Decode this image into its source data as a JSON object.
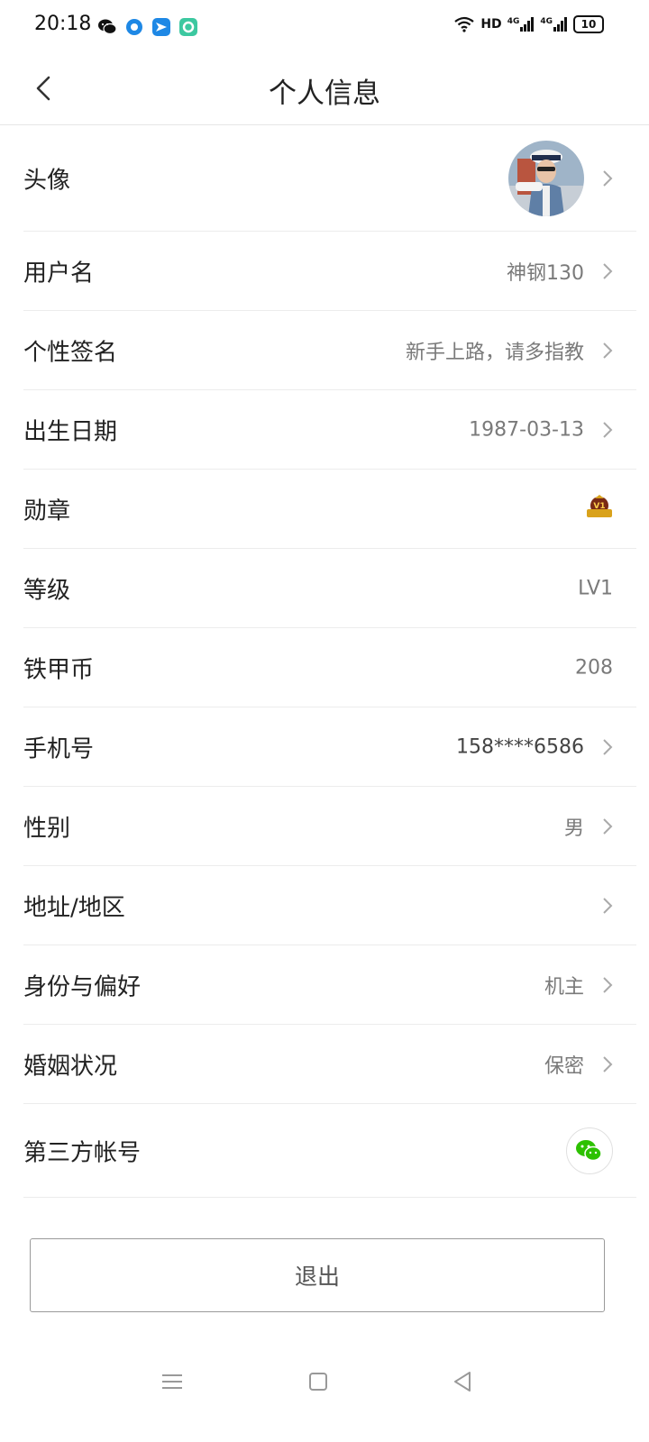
{
  "status_bar": {
    "time": "20:18",
    "network": "HD",
    "signal_1": "4G",
    "signal_2": "4G",
    "battery": "10"
  },
  "header": {
    "title": "个人信息"
  },
  "rows": {
    "avatar": {
      "label": "头像"
    },
    "username": {
      "label": "用户名",
      "value": "神钢130"
    },
    "signature": {
      "label": "个性签名",
      "value": "新手上路，请多指教"
    },
    "birthday": {
      "label": "出生日期",
      "value": "1987-03-13"
    },
    "medal": {
      "label": "勋章",
      "medal_text": "V1"
    },
    "level": {
      "label": "等级",
      "value": "LV1"
    },
    "coins": {
      "label": "铁甲币",
      "value": "208"
    },
    "phone": {
      "label": "手机号",
      "value": "158****6586"
    },
    "gender": {
      "label": "性别",
      "value": "男"
    },
    "address": {
      "label": "地址/地区",
      "value": ""
    },
    "identity": {
      "label": "身份与偏好",
      "value": "机主"
    },
    "marital": {
      "label": "婚姻状况",
      "value": "保密"
    },
    "third_party": {
      "label": "第三方帐号"
    }
  },
  "logout_label": "退出",
  "colors": {
    "wechat_green": "#2dc100",
    "medal_gold": "#d9a21b",
    "medal_dark": "#7a2a14"
  },
  "icons": [
    "back-icon",
    "chevron-right-icon",
    "wechat-icon",
    "medal-icon",
    "nav-menu-icon",
    "nav-home-icon",
    "nav-back-icon"
  ]
}
